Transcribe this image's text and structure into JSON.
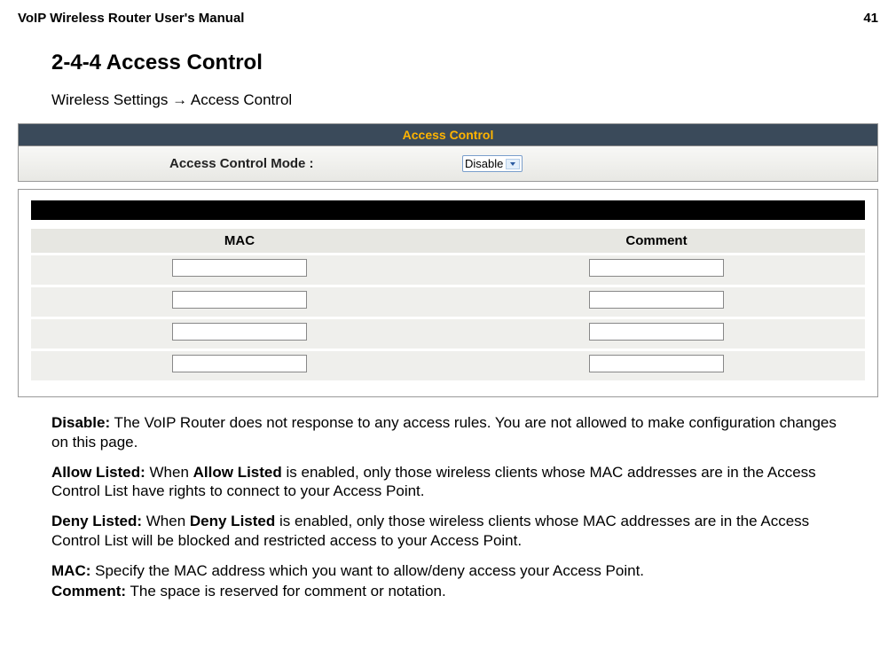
{
  "header": {
    "title": "VoIP Wireless Router User's Manual",
    "page_number": "41"
  },
  "section": {
    "heading": "2-4-4 Access Control",
    "breadcrumb_prefix": "Wireless Settings",
    "breadcrumb_arrow": "→",
    "breadcrumb_suffix": "Access Control"
  },
  "panel": {
    "title": "Access Control",
    "mode_label": "Access Control Mode :",
    "mode_value": "Disable"
  },
  "table": {
    "col_mac": "MAC",
    "col_comment": "Comment"
  },
  "defs": {
    "disable_label": "Disable:",
    "disable_text": " The VoIP Router does not response to any access rules. You are not allowed to make configuration changes on this page.",
    "allow_label": "Allow Listed:",
    "allow_text_1": " When ",
    "allow_text_bold": "Allow Listed",
    "allow_text_2": " is enabled, only those wireless clients whose MAC addresses are in the Access Control List have rights to connect to your Access Point.",
    "deny_label": "Deny Listed:",
    "deny_text_1": " When ",
    "deny_text_bold": "Deny Listed",
    "deny_text_2": " is enabled, only those wireless clients whose MAC addresses are in the Access Control List will be blocked and restricted access to your Access Point.",
    "mac_label": "MAC:",
    "mac_text": " Specify the MAC address which you want to allow/deny access your Access Point.",
    "comment_label": "Comment:",
    "comment_text": " The space is reserved for comment or notation."
  }
}
